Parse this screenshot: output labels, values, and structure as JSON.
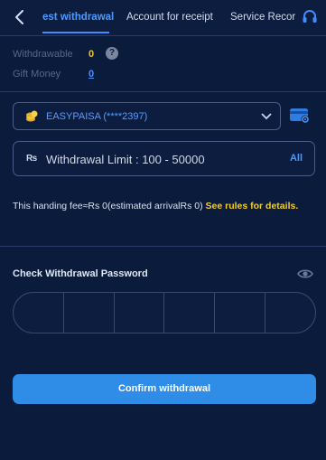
{
  "header": {
    "tabs": [
      {
        "label": "est withdrawal",
        "active": true
      },
      {
        "label": "Account for receipt",
        "active": false
      },
      {
        "label": "Service Recor",
        "active": false
      }
    ],
    "back_icon": "chevron-left-icon",
    "support_icon": "headset-icon"
  },
  "balances": {
    "withdrawable_label": "Withdrawable",
    "withdrawable_value": "0",
    "gift_label": "Gift Money",
    "gift_value": "0"
  },
  "account": {
    "selected": "EASYPAISA (****2397)",
    "icon": "coin-icon"
  },
  "amount": {
    "currency_symbol": "₨",
    "placeholder": "Withdrawal Limit : 100 - 50000",
    "value": "",
    "all_label": "All"
  },
  "fee": {
    "text": "This handing fee≈Rs 0(estimated arrivalRs 0) ",
    "rules_link": "See rules for details",
    "suffix": "."
  },
  "password": {
    "label": "Check Withdrawal Password",
    "digits": 6
  },
  "confirm_label": "Confirm withdrawal",
  "colors": {
    "background": "#0b1b3c",
    "accent": "#2f8de8",
    "highlight": "#f2c230"
  }
}
